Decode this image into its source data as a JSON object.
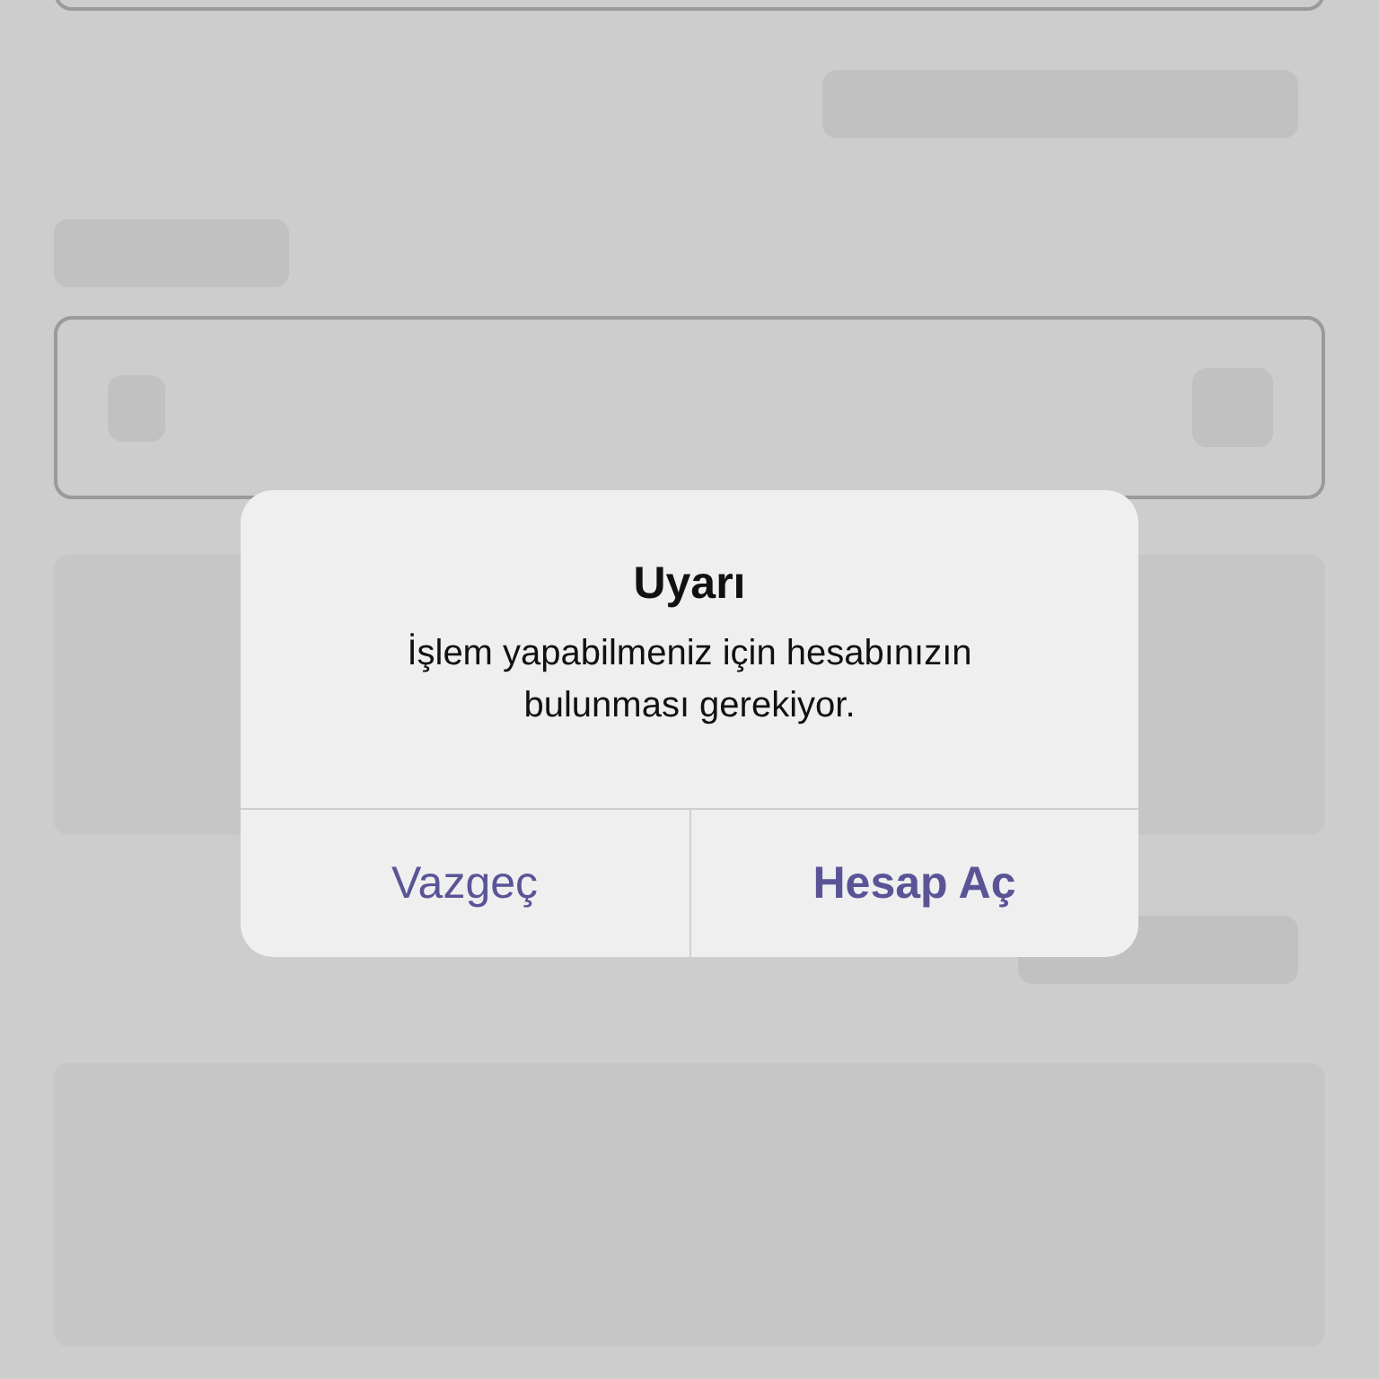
{
  "alert": {
    "title": "Uyarı",
    "message": "İşlem yapabilmeniz için hesabınızın bulunması gerekiyor.",
    "buttons": [
      {
        "label": "Vazgeç",
        "kind": "cancel"
      },
      {
        "label": "Hesap Aç",
        "kind": "default"
      }
    ]
  }
}
